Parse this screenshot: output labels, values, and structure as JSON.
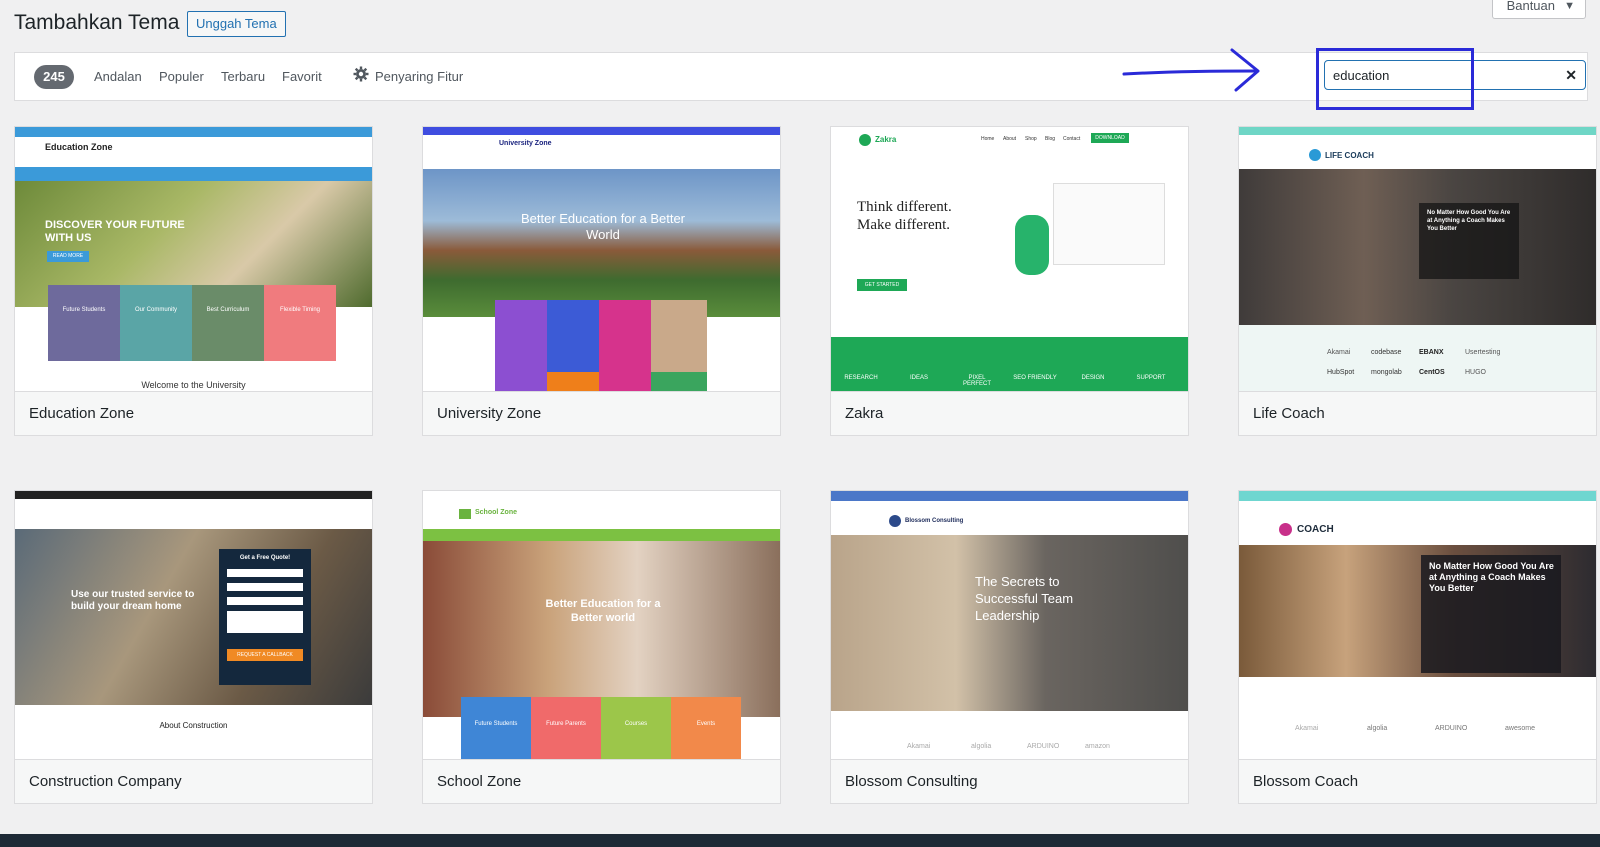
{
  "header": {
    "title": "Tambahkan Tema",
    "upload_label": "Unggah Tema",
    "help_label": "Bantuan"
  },
  "filters": {
    "count": "245",
    "links": [
      "Andalan",
      "Populer",
      "Terbaru",
      "Favorit"
    ],
    "feature_filter": "Penyaring Fitur"
  },
  "search": {
    "value": "education",
    "clear_icon": "close-icon"
  },
  "colors": {
    "accent": "#2271b1",
    "annotation": "#2a2ad8"
  },
  "themes": [
    {
      "name": "Education Zone",
      "shot": {
        "brand": "Education Zone",
        "hero": "DISCOVER YOUR FUTURE WITH US",
        "button": "READ MORE",
        "tiles": [
          "Future Students",
          "Our Community",
          "Best Curriculum",
          "Flexible Timing"
        ],
        "footer_text": "Welcome to the University"
      }
    },
    {
      "name": "University Zone",
      "shot": {
        "brand": "University Zone",
        "hero": "Better Education for a Better World"
      }
    },
    {
      "name": "Zakra",
      "shot": {
        "brand": "Zakra",
        "nav": [
          "Home",
          "About",
          "Shop",
          "Blog",
          "Contact"
        ],
        "nav_button": "DOWNLOAD",
        "hero_line1": "Think different.",
        "hero_line2": "Make different.",
        "button": "GET STARTED",
        "features": [
          "RESEARCH",
          "IDEAS",
          "PIXEL PERFECT",
          "SEO FRIENDLY",
          "DESIGN",
          "SUPPORT"
        ]
      }
    },
    {
      "name": "Life Coach",
      "shot": {
        "brand": "LIFE COACH",
        "hero": "No Matter How Good You Are at Anything a Coach Makes You Better",
        "logos": [
          "Akamai",
          "codebase",
          "EBANX",
          "Usertesting",
          "HubSpot",
          "mongolab",
          "CentOS",
          "HUGO"
        ]
      }
    },
    {
      "name": "Construction Company",
      "shot": {
        "hero": "Use our trusted service to build your dream home",
        "quote_title": "Get a Free Quote!",
        "quote_button": "REQUEST A CALLBACK",
        "section_title": "About Construction"
      }
    },
    {
      "name": "School Zone",
      "shot": {
        "brand": "School Zone",
        "hero": "Better Education for a Better world",
        "tiles": [
          "Future Students",
          "Future Parents",
          "Courses",
          "Events"
        ]
      }
    },
    {
      "name": "Blossom Consulting",
      "shot": {
        "brand": "Blossom Consulting",
        "hero": "The Secrets to Successful Team Leadership",
        "logos": [
          "Akamai",
          "algolia",
          "ARDUINO",
          "amazon"
        ]
      }
    },
    {
      "name": "Blossom Coach",
      "shot": {
        "brand": "COACH",
        "hero": "No Matter How Good You Are at Anything a Coach Makes You Better",
        "logos": [
          "Akamai",
          "algolia",
          "ARDUINO",
          "awesome"
        ]
      }
    }
  ]
}
